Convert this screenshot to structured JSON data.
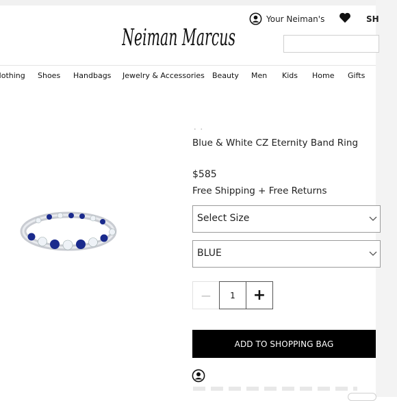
{
  "header": {
    "logo_text": "Neiman Marcus",
    "account_label": "Your Neiman's",
    "shop_label": "SH",
    "search_placeholder": ""
  },
  "nav": {
    "items": [
      "Clothing",
      "Shoes",
      "Handbags",
      "Jewelry & Accessories",
      "Beauty",
      "Men",
      "Kids",
      "Home",
      "Gifts"
    ]
  },
  "product": {
    "title": "Blue & White CZ Eternity Band Ring",
    "price": "$585",
    "shipping": "Free Shipping + Free Returns",
    "size_select": {
      "selected": "Select Size"
    },
    "color_select": {
      "selected": "BLUE"
    },
    "quantity": {
      "value": "1",
      "minus_symbol": "−",
      "plus_symbol": "+"
    },
    "add_to_bag_label": "ADD TO SHOPPING BAG",
    "colors": {
      "sapphire": "#1a2a8c",
      "stone": "#eef2f7",
      "metal": "#c9ccd2"
    }
  },
  "icons": {
    "account": "user-circle-icon",
    "wishlist": "heart-icon",
    "chevron": "chevron-down-icon",
    "bottom": "user-circle-icon"
  }
}
